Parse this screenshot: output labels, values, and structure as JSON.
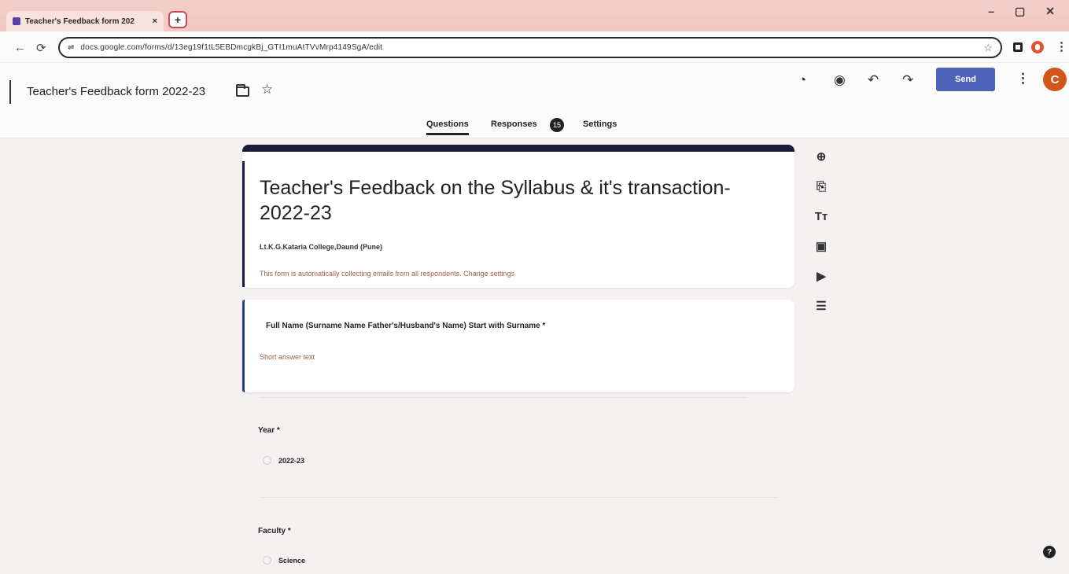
{
  "browser": {
    "tab_title": "Teacher's Feedback form 202",
    "tab_close": "×",
    "new_tab": "+",
    "window_controls": [
      "–",
      "▢",
      "✕"
    ],
    "url": "docs.google.com/forms/d/13eg19f1tL5EBDmcgkBj_GTI1muAtTVvMrp4149SgA/edit"
  },
  "header": {
    "doc_title": "Teacher's Feedback form 2022-23",
    "send_label": "Send",
    "avatar_initial": "C"
  },
  "tabs": {
    "questions": "Questions",
    "responses": "Responses",
    "responses_count": "15",
    "settings": "Settings"
  },
  "form": {
    "title": "Teacher's Feedback on the Syllabus & it's transaction-  2022-23",
    "description": "Lt.K.G.Kataria College,Daund (Pune)",
    "email_note": "This form is automatically collecting emails from all respondents.  Change settings"
  },
  "questions": {
    "q1_title": "Full Name (Surname Name Father's/Husband's Name) Start with Surname  *",
    "q1_hint": "Short answer text",
    "q2_title": "Year *",
    "q2_option": "2022-23",
    "q3_title": "Faculty *",
    "q3_option": "Science"
  }
}
